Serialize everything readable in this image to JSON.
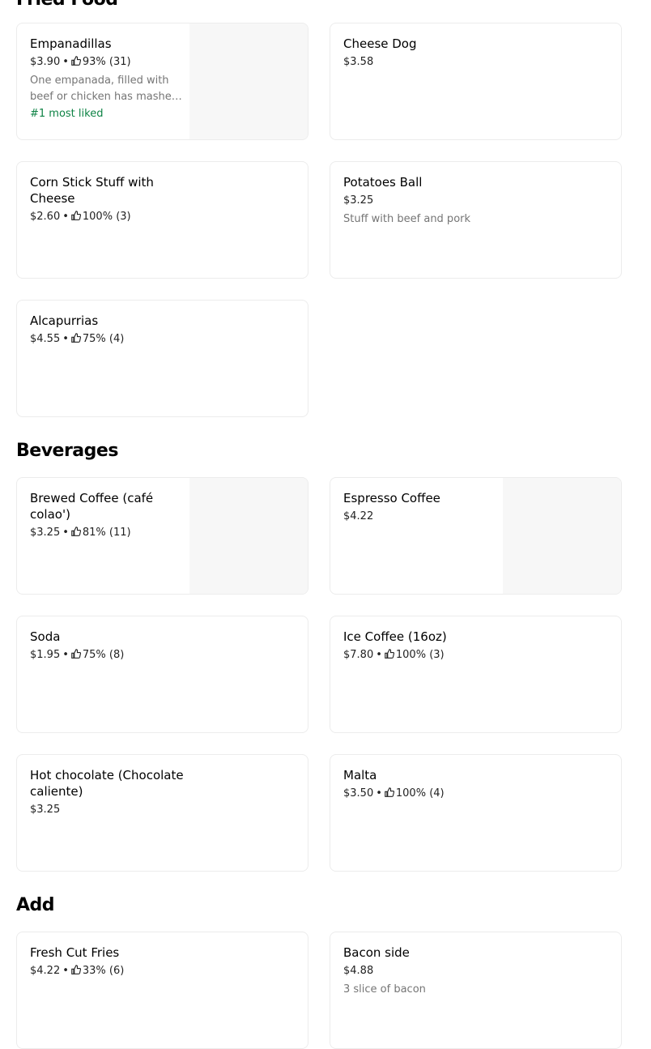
{
  "sections": {
    "fried_food": {
      "title": "Fried Food"
    },
    "beverages": {
      "title": "Beverages"
    },
    "add": {
      "title": "Add"
    }
  },
  "items": {
    "empanadillas": {
      "name": "Empanadillas",
      "price": "$3.90",
      "rating": "93% (31)",
      "description": "One empanada, filled with beef or chicken has mashed potatoes",
      "badge": "#1 most liked"
    },
    "cheese_dog": {
      "name": "Cheese Dog",
      "price": "$3.58"
    },
    "corn_stick": {
      "name": "Corn Stick Stuff with Cheese",
      "price": "$2.60",
      "rating": "100% (3)"
    },
    "potatoes_ball": {
      "name": "Potatoes Ball",
      "price": "$3.25",
      "description": "Stuff with beef and pork"
    },
    "alcapurrias": {
      "name": "Alcapurrias",
      "price": "$4.55",
      "rating": "75% (4)"
    },
    "brewed_coffee": {
      "name": "Brewed Coffee (café colao')",
      "price": "$3.25",
      "rating": "81% (11)"
    },
    "espresso_coffee": {
      "name": "Espresso Coffee",
      "price": "$4.22"
    },
    "soda": {
      "name": "Soda",
      "price": "$1.95",
      "rating": "75% (8)"
    },
    "ice_coffee": {
      "name": "Ice Coffee (16oz)",
      "price": "$7.80",
      "rating": "100% (3)"
    },
    "hot_chocolate": {
      "name": "Hot chocolate (Chocolate caliente)",
      "price": "$3.25"
    },
    "malta": {
      "name": "Malta",
      "price": "$3.50",
      "rating": "100% (4)"
    },
    "fresh_cut_fries": {
      "name": "Fresh Cut Fries",
      "price": "$4.22",
      "rating": "33% (6)"
    },
    "bacon_side": {
      "name": "Bacon side",
      "price": "$4.88",
      "description": "3 slice of bacon"
    }
  },
  "separator": "•",
  "icons": {
    "rating": "thumbs-up-icon"
  },
  "colors": {
    "badge": "#0e8345",
    "thumb_placeholder": "#f7f7f7",
    "card_border": "#ececec"
  }
}
